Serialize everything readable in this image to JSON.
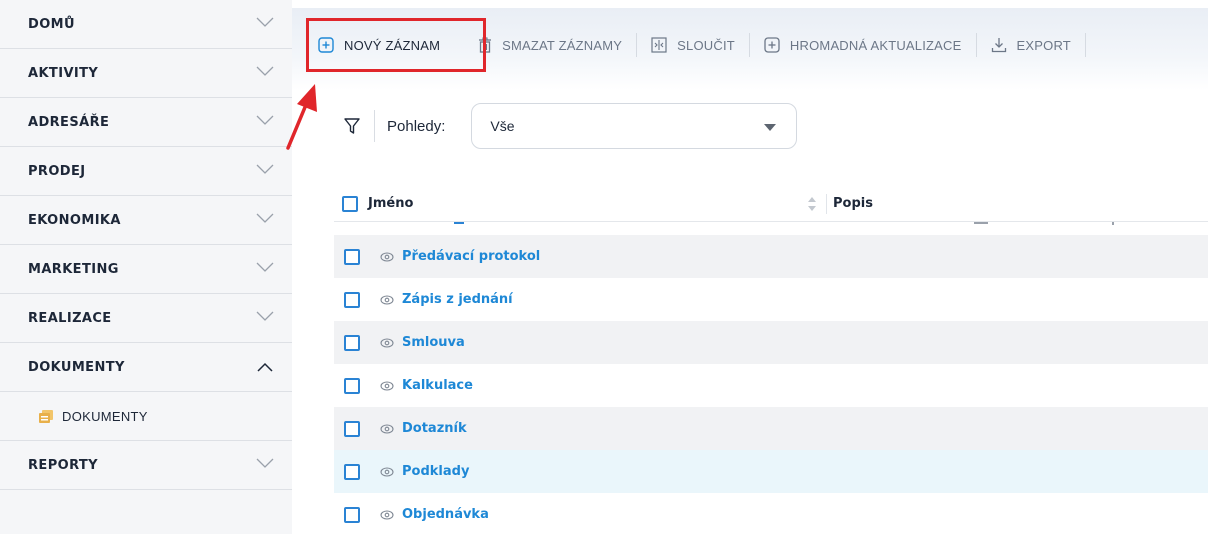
{
  "sidebar": {
    "items": [
      {
        "label": "DOMŮ",
        "expanded": false
      },
      {
        "label": "AKTIVITY",
        "expanded": false
      },
      {
        "label": "ADRESÁŘE",
        "expanded": false
      },
      {
        "label": "PRODEJ",
        "expanded": false
      },
      {
        "label": "EKONOMIKA",
        "expanded": false
      },
      {
        "label": "MARKETING",
        "expanded": false
      },
      {
        "label": "REALIZACE",
        "expanded": false
      },
      {
        "label": "DOKUMENTY",
        "expanded": true
      },
      {
        "label": "REPORTY",
        "expanded": false
      }
    ],
    "subitem": {
      "label": "DOKUMENTY",
      "icon": "folder-icon"
    }
  },
  "toolbar": {
    "new_record": "NOVÝ ZÁZNAM",
    "delete_records": "SMAZAT ZÁZNAMY",
    "merge": "SLOUČIT",
    "bulk_update": "HROMADNÁ AKTUALIZACE",
    "export": "EXPORT"
  },
  "filter": {
    "label": "Pohledy:",
    "selected_view": "Vše"
  },
  "table": {
    "columns": [
      "Jméno",
      "Popis"
    ],
    "rows": [
      "Předávací protokol",
      "Zápis z jednání",
      "Smlouva",
      "Kalkulace",
      "Dotazník",
      "Podklady",
      "Objednávka"
    ]
  },
  "colors": {
    "accent": "#1e88d6",
    "highlight": "#e0262b",
    "text": "#1d2738",
    "folder": "#e8b04a"
  }
}
